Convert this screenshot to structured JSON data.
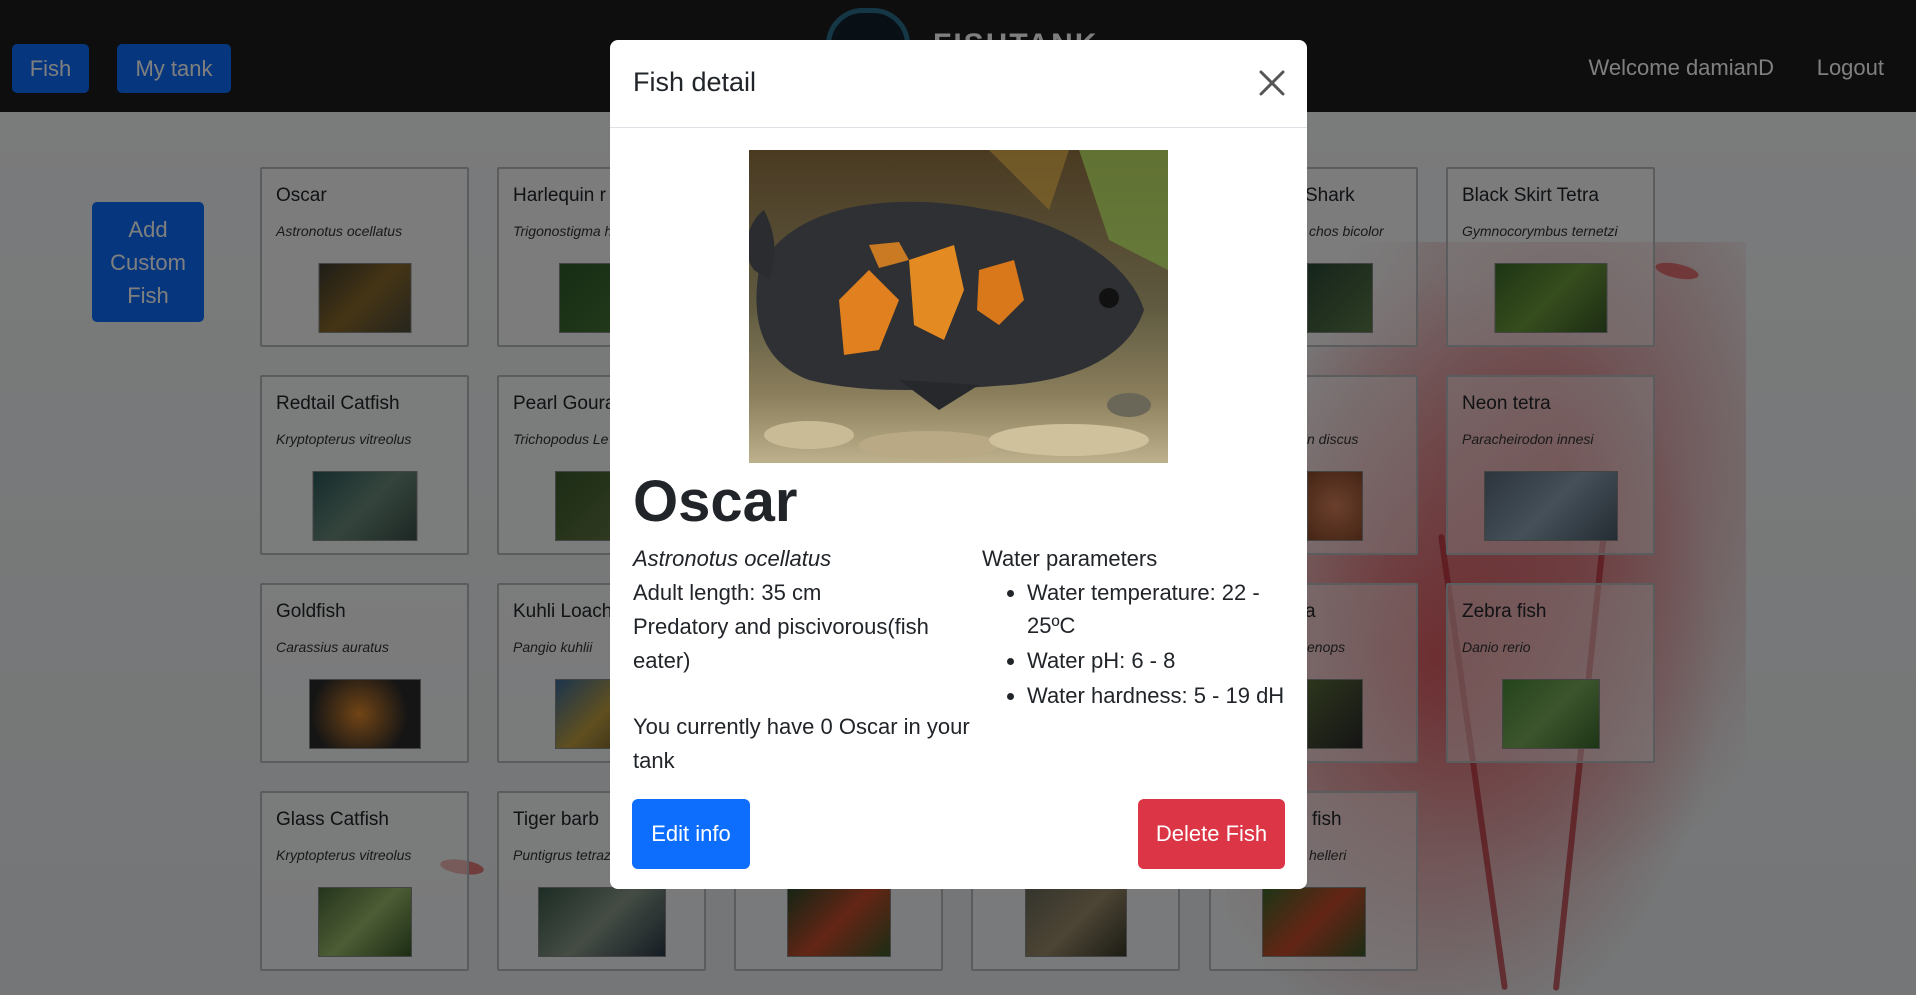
{
  "navbar": {
    "fish_label": "Fish",
    "my_tank_label": "My tank",
    "brand_text": "FISHTANK",
    "welcome_text": "Welcome damianD",
    "logout_label": "Logout"
  },
  "main": {
    "add_custom_label": "Add Custom Fish",
    "cards": [
      {
        "name": "Oscar",
        "scientific": "Astronotus ocellatus"
      },
      {
        "name": "Harlequin r",
        "scientific": "Trigonostigma heteromorpha"
      },
      {
        "name": "Shark",
        "scientific": "chos bicolor"
      },
      {
        "name": "Black Skirt Tetra",
        "scientific": "Gymnocorymbus ternetzi"
      },
      {
        "name": "Redtail Catfish",
        "scientific": "Kryptopterus vitreolus"
      },
      {
        "name": "Pearl Goura",
        "scientific": "Trichopodus Le"
      },
      {
        "name": "",
        "scientific": "n discus"
      },
      {
        "name": "Neon tetra",
        "scientific": "Paracheirodon innesi"
      },
      {
        "name": "Goldfish",
        "scientific": "Carassius auratus"
      },
      {
        "name": "Kuhli Loach",
        "scientific": "Pangio kuhlii"
      },
      {
        "name": "a",
        "scientific": "enops"
      },
      {
        "name": "Zebra fish",
        "scientific": "Danio rerio"
      },
      {
        "name": "Glass Catfish",
        "scientific": "Kryptopterus vitreolus"
      },
      {
        "name": "Tiger barb",
        "scientific": "Puntigrus tetraz"
      },
      {
        "name": "",
        "scientific": ""
      },
      {
        "name": "",
        "scientific": ""
      },
      {
        "name": "fish",
        "scientific": "helleri"
      }
    ]
  },
  "modal": {
    "title": "Fish detail",
    "fish_name": "Oscar",
    "scientific_name": "Astronotus ocellatus",
    "adult_length": "Adult length: 35 cm",
    "diet": "Predatory and piscivorous(fish eater)",
    "tank_count": "You currently have 0 Oscar in your tank",
    "water_heading": "Water parameters",
    "water_params": [
      "Water temperature: 22 - 25ºC",
      "Water pH: 6 - 8",
      "Water hardness: 5 - 19 dH"
    ],
    "edit_label": "Edit info",
    "delete_label": "Delete Fish"
  },
  "icons": {
    "close": "close-icon",
    "logo": "fishbowl-logo-icon"
  },
  "colors": {
    "primary": "#0d6efd",
    "danger": "#dc3545",
    "navbar": "#1c1c1c"
  }
}
